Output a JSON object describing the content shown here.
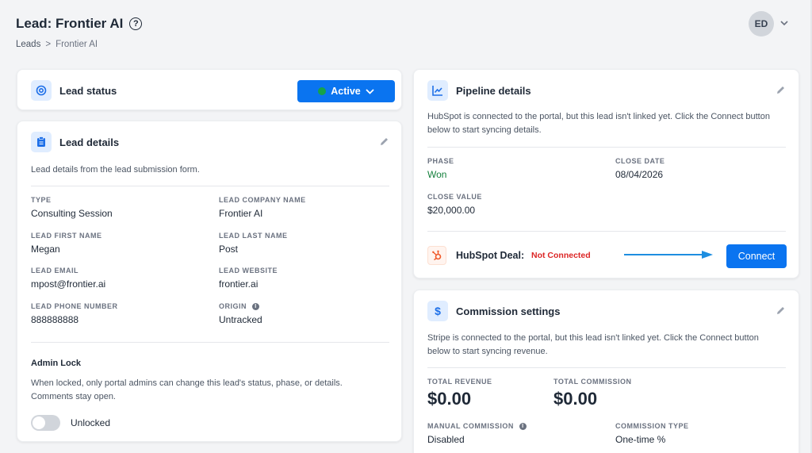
{
  "header": {
    "title": "Lead: Frontier AI",
    "breadcrumb": {
      "root": "Leads",
      "separator": ">",
      "current": "Frontier AI"
    },
    "avatar_initials": "ED"
  },
  "lead_status": {
    "title": "Lead status",
    "status_value": "Active",
    "status_color": "#16a34a"
  },
  "lead_details": {
    "title": "Lead details",
    "description": "Lead details from the lead submission form.",
    "fields": {
      "type_label": "TYPE",
      "type_value": "Consulting Session",
      "company_label": "LEAD COMPANY NAME",
      "company_value": "Frontier AI",
      "first_label": "LEAD FIRST NAME",
      "first_value": "Megan",
      "last_label": "LEAD LAST NAME",
      "last_value": "Post",
      "email_label": "LEAD EMAIL",
      "email_value": "mpost@frontier.ai",
      "website_label": "LEAD WEBSITE",
      "website_value": "frontier.ai",
      "phone_label": "LEAD PHONE NUMBER",
      "phone_value": "888888888",
      "origin_label": "ORIGIN",
      "origin_value": "Untracked"
    },
    "admin_lock": {
      "title": "Admin Lock",
      "description_line1": "When locked, only portal admins can change this lead's status, phase, or details.",
      "description_line2": "Comments stay open.",
      "toggle_label": "Unlocked"
    }
  },
  "pipeline": {
    "title": "Pipeline details",
    "description_line1": "HubSpot is connected to the portal, but this lead isn't linked yet. Click the Connect button",
    "description_line2": "below to start syncing details.",
    "phase_label": "PHASE",
    "phase_value": "Won",
    "close_date_label": "CLOSE DATE",
    "close_date_value": "08/04/2026",
    "close_value_label": "CLOSE VALUE",
    "close_value_value": "$20,000.00",
    "hubspot_label": "HubSpot Deal:",
    "hubspot_status": "Not Connected",
    "connect_label": "Connect"
  },
  "commission": {
    "title": "Commission settings",
    "description_line1": "Stripe is connected to the portal, but this lead isn't linked yet. Click the Connect button",
    "description_line2": "below to start syncing revenue.",
    "total_revenue_label": "TOTAL REVENUE",
    "total_revenue_value": "$0.00",
    "total_commission_label": "TOTAL COMMISSION",
    "total_commission_value": "$0.00",
    "manual_label": "MANUAL COMMISSION",
    "manual_value": "Disabled",
    "type_label": "COMMISSION TYPE",
    "type_value": "One-time %"
  },
  "colors": {
    "accent": "#0a74f0",
    "won": "#15803d",
    "not_connected": "#dc2626",
    "arrow": "#1e8ee0"
  },
  "icons": {
    "help": "question-circle-icon",
    "status": "target-icon",
    "details": "clipboard-icon",
    "pipeline": "chart-line-icon",
    "commission": "dollar-icon",
    "edit": "pencil-icon",
    "hubspot": "hubspot-logo-icon",
    "info": "info-icon"
  }
}
